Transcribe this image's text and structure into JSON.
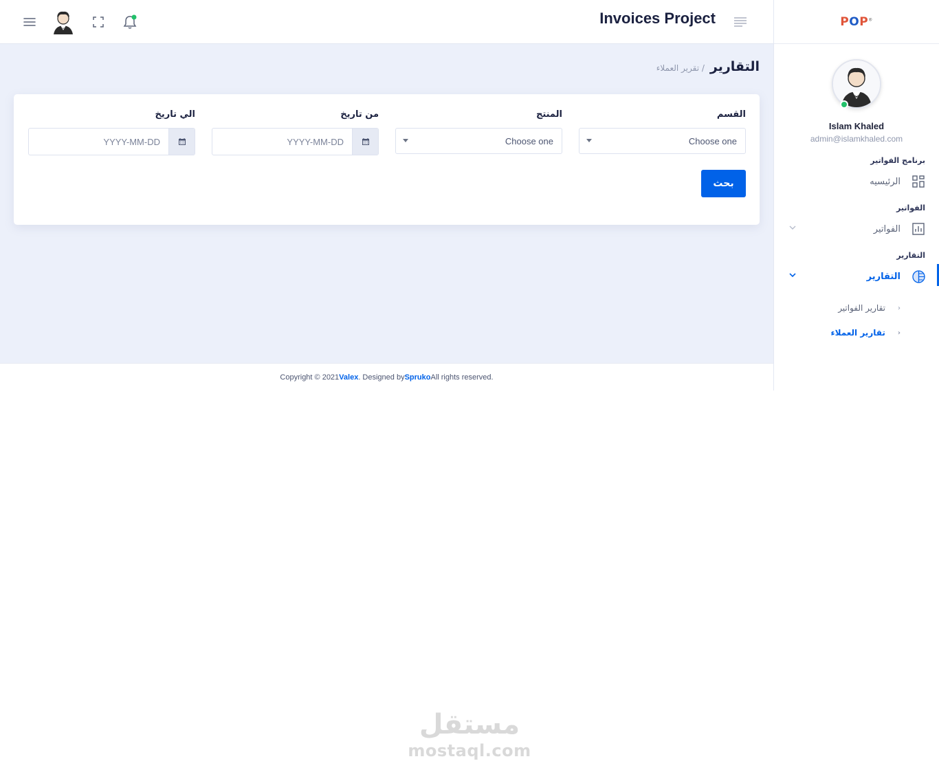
{
  "header": {
    "app_title": "Invoices Project"
  },
  "sidebar": {
    "logo": {
      "part1": "P",
      "part2": "O",
      "part3": "P"
    },
    "profile": {
      "name": "Islam Khaled",
      "email": "admin@islamkhaled.com",
      "status": "online"
    },
    "sections": [
      {
        "category": "برنامج الفواتير",
        "item": {
          "label": "الرئيسيه",
          "icon": "dashboard-grid-icon"
        }
      },
      {
        "category": "الفواتير",
        "item": {
          "label": "الفواتير",
          "icon": "bar-chart-icon"
        }
      },
      {
        "category": "التقارير",
        "item": {
          "label": "التقارير",
          "icon": "pie-chart-icon",
          "active": true
        }
      }
    ],
    "sub_items": [
      {
        "label": "تقارير الفواتير",
        "active": false
      },
      {
        "label": "تقارير العملاء",
        "active": true
      }
    ]
  },
  "page": {
    "title": "التقارير",
    "breadcrumb": "/ تقرير العملاء"
  },
  "form": {
    "section": {
      "label": "القسم",
      "value": "Choose one"
    },
    "product": {
      "label": "المنتج",
      "value": "Choose one"
    },
    "from_date": {
      "label": "من تاريخ",
      "placeholder": "YYYY-MM-DD"
    },
    "to_date": {
      "label": "الي تاريخ",
      "placeholder": "YYYY-MM-DD"
    },
    "search_label": "بحث"
  },
  "footer": {
    "prefix": "Copyright © 2021 ",
    "brand": "Valex",
    "middle": ". Designed by ",
    "designer": "Spruko",
    "suffix": " All rights reserved."
  },
  "watermark": {
    "arabic": "مستقل",
    "latin": "mostaql.com"
  },
  "colors": {
    "primary": "#0162e8",
    "background": "#ecf0fa",
    "online": "#22c06a",
    "logo_accent": "#e0553a"
  }
}
